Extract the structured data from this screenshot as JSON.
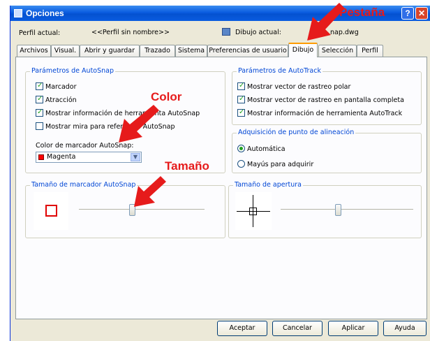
{
  "window": {
    "title": "Opciones",
    "help_label": "?",
    "close_label": "✕"
  },
  "header": {
    "profile_label": "Perfil actual:",
    "profile_value": "<<Perfil sin nombre>>",
    "drawing_label": "Dibujo actual:",
    "drawing_value": "nap.dwg"
  },
  "tabs": [
    {
      "label": "Archivos"
    },
    {
      "label": "Visual."
    },
    {
      "label": "Abrir y guardar"
    },
    {
      "label": "Trazado"
    },
    {
      "label": "Sistema"
    },
    {
      "label": "Preferencias de usuario"
    },
    {
      "label": "Dibujo",
      "active": true
    },
    {
      "label": "Selección"
    },
    {
      "label": "Perfil"
    }
  ],
  "autosnap": {
    "title": "Parámetros de AutoSnap",
    "options": [
      {
        "label": "Marcador",
        "checked": true
      },
      {
        "label": "Atracción",
        "checked": true
      },
      {
        "label": "Mostrar información de herramienta AutoSnap",
        "checked": true
      },
      {
        "label": "Mostrar mira para referencia AutoSnap",
        "checked": false
      }
    ],
    "color_label": "Color de marcador AutoSnap:",
    "color_value": "Magenta",
    "color_swatch": "#ff0000"
  },
  "autotrack": {
    "title": "Parámetros de AutoTrack",
    "options": [
      {
        "label": "Mostrar vector de rastreo polar",
        "checked": true
      },
      {
        "label": "Mostrar vector de rastreo en pantalla completa",
        "checked": true
      },
      {
        "label": "Mostrar información de herramienta AutoTrack",
        "checked": true
      }
    ]
  },
  "alignment": {
    "title": "Adquisición de punto de alineación",
    "options": [
      {
        "label": "Automática",
        "selected": true
      },
      {
        "label": "Mayús para adquirir",
        "selected": false
      }
    ]
  },
  "marker_size": {
    "title": "Tamaño de marcador AutoSnap",
    "slider_fraction": 0.42
  },
  "aperture_size": {
    "title": "Tamaño de apertura",
    "slider_fraction": 0.43
  },
  "buttons": {
    "ok": "Aceptar",
    "cancel": "Cancelar",
    "apply": "Aplicar",
    "help": "Ayuda"
  },
  "annotations": {
    "tab": "Pestaña",
    "color": "Color",
    "size": "Tamaño",
    "color_hex": "#e61b1b"
  }
}
